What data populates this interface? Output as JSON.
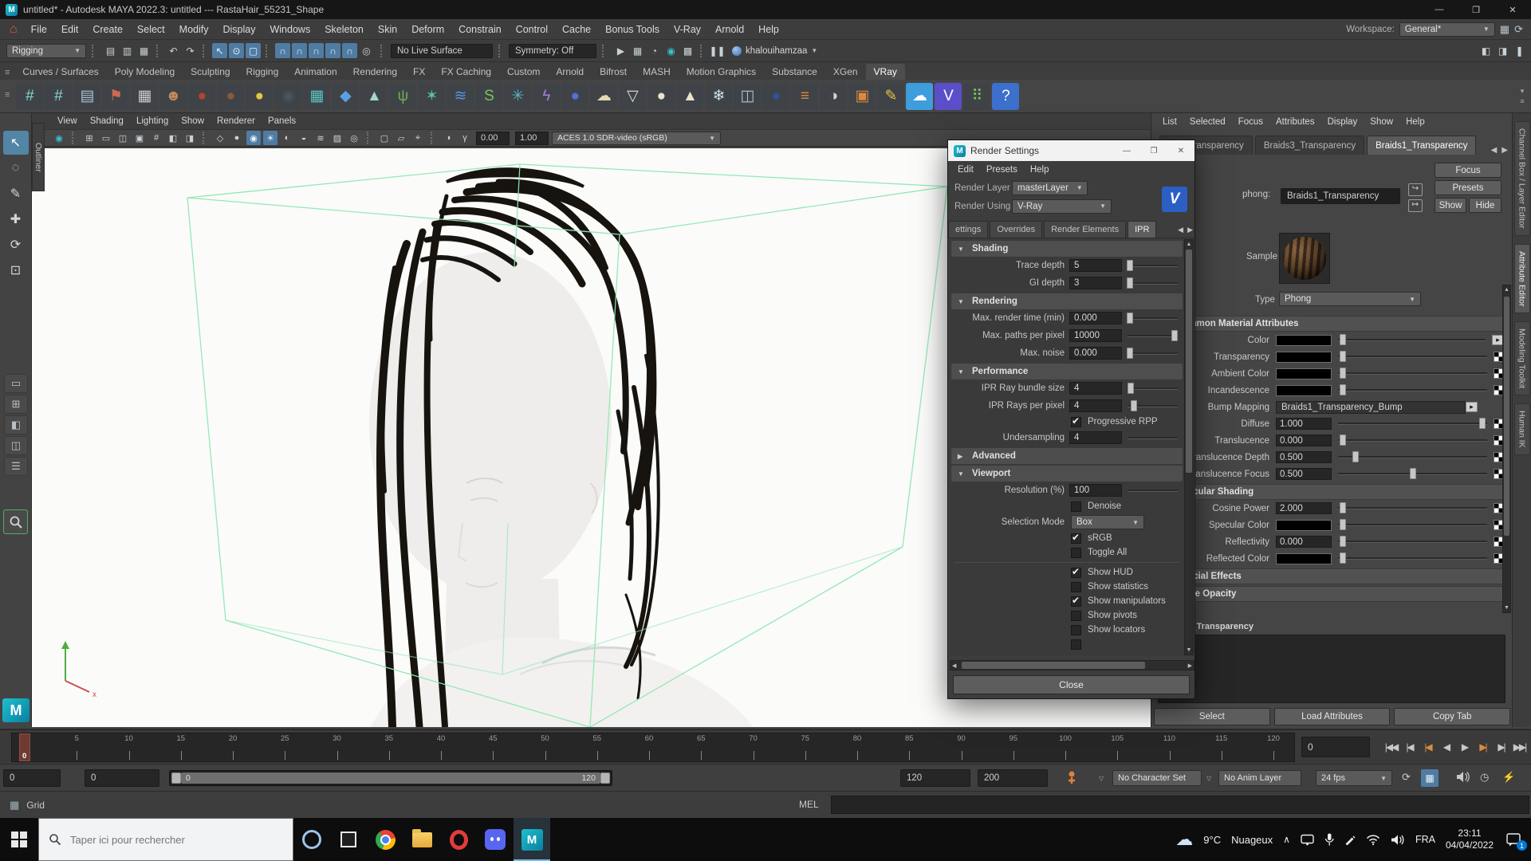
{
  "window": {
    "title": "untitled* - Autodesk MAYA 2022.3: untitled   ---   RastaHair_55231_Shape",
    "minimize": "—",
    "maximize": "❐",
    "close": "✕"
  },
  "menubar": {
    "items": [
      "File",
      "Edit",
      "Create",
      "Select",
      "Modify",
      "Display",
      "Windows",
      "Skeleton",
      "Skin",
      "Deform",
      "Constrain",
      "Control",
      "Cache",
      "Bonus Tools",
      "V-Ray",
      "Arnold",
      "Help"
    ],
    "workspace_label": "Workspace:",
    "workspace_value": "General*"
  },
  "statusline": {
    "menuset": "Rigging",
    "no_live_surface": "No Live Surface",
    "symmetry": "Symmetry: Off",
    "user": "khalouihamzaa",
    "icons_left": [
      {
        "n": "new-scene-icon",
        "g": "▤"
      },
      {
        "n": "open-scene-icon",
        "g": "▥"
      },
      {
        "n": "save-scene-icon",
        "g": "▦"
      },
      {
        "sep": 1
      },
      {
        "n": "undo-icon",
        "g": "↶"
      },
      {
        "n": "redo-icon",
        "g": "↷"
      },
      {
        "sep": 1
      },
      {
        "n": "select-hierarchy-icon",
        "g": "↖",
        "hl": 1
      },
      {
        "n": "select-object-icon",
        "g": "⊙",
        "hl": 1
      },
      {
        "n": "select-component-icon",
        "g": "▢",
        "hl": 1
      },
      {
        "sep": 1
      },
      {
        "n": "snap-to-grid-icon",
        "g": "∩",
        "hl": 1
      },
      {
        "n": "snap-to-curve-icon",
        "g": "∩",
        "hl": 1
      },
      {
        "n": "snap-to-point-icon",
        "g": "∩",
        "hl": 1
      },
      {
        "n": "snap-to-center-icon",
        "g": "∩",
        "hl": 1
      },
      {
        "n": "snap-to-viewplane-icon",
        "g": "∩",
        "hl": 1
      },
      {
        "n": "make-live-icon",
        "g": "◎"
      }
    ],
    "icons_render": [
      {
        "n": "render-view-icon",
        "g": "▶"
      },
      {
        "n": "render-current-frame-icon",
        "g": "▦"
      },
      {
        "n": "ipr-render-icon",
        "g": "◔"
      },
      {
        "n": "render-setup-icon",
        "g": "◉",
        "teal": 1
      },
      {
        "n": "render-settings-icon",
        "g": "▩"
      },
      {
        "sep": 1
      },
      {
        "n": "pause-viewport-icon",
        "g": "❚❚"
      }
    ],
    "icons_right": [
      {
        "n": "modeling-toolkit-toggle-icon",
        "g": "◧"
      },
      {
        "n": "attribute-editor-toggle-icon",
        "g": "◨"
      },
      {
        "n": "tool-settings-toggle-icon",
        "g": "❚"
      }
    ]
  },
  "shelf": {
    "tabs": [
      {
        "label": "Curves / Surfaces"
      },
      {
        "label": "Poly Modeling"
      },
      {
        "label": "Sculpting"
      },
      {
        "label": "Rigging"
      },
      {
        "label": "Animation"
      },
      {
        "label": "Rendering"
      },
      {
        "label": "FX"
      },
      {
        "label": "FX Caching"
      },
      {
        "label": "Custom"
      },
      {
        "label": "Arnold"
      },
      {
        "label": "Bifrost"
      },
      {
        "label": "MASH"
      },
      {
        "label": "Motion Graphics"
      },
      {
        "label": "Substance"
      },
      {
        "label": "XGen"
      },
      {
        "label": "VRay",
        "active": true
      }
    ],
    "icons": [
      {
        "n": "shelf-icon-1",
        "g": "#",
        "c": "#86d7d2"
      },
      {
        "n": "shelf-icon-2",
        "g": "#",
        "c": "#86d7d2"
      },
      {
        "n": "shelf-icon-3",
        "g": "▤",
        "c": "#a9c2d4"
      },
      {
        "n": "shelf-icon-4",
        "g": "⚑",
        "c": "#cd6a52"
      },
      {
        "n": "shelf-icon-5",
        "g": "▦",
        "c": "#cccccc"
      },
      {
        "n": "shelf-icon-6",
        "g": "☻",
        "c": "#c08a5a"
      },
      {
        "n": "shelf-icon-7",
        "g": "●",
        "c": "#b8412f"
      },
      {
        "n": "shelf-icon-8",
        "g": "●",
        "c": "#8a5a38"
      },
      {
        "n": "shelf-icon-9",
        "g": "●",
        "c": "#e3c53f"
      },
      {
        "n": "shelf-icon-10",
        "g": "◉",
        "c": "#49555e"
      },
      {
        "n": "shelf-icon-11",
        "g": "▦",
        "c": "#57c4c4"
      },
      {
        "n": "shelf-icon-12",
        "g": "◆",
        "c": "#5a9fe3"
      },
      {
        "n": "shelf-icon-13",
        "g": "▲",
        "c": "#a3d8cd"
      },
      {
        "n": "shelf-icon-14",
        "g": "ψ",
        "c": "#6fae4f"
      },
      {
        "n": "shelf-icon-15",
        "g": "✶",
        "c": "#57c49e"
      },
      {
        "n": "shelf-icon-16",
        "g": "≋",
        "c": "#5a8fe3"
      },
      {
        "n": "shelf-icon-17",
        "g": "S",
        "c": "#79c45a"
      },
      {
        "n": "shelf-icon-18",
        "g": "✳",
        "c": "#57b2c4"
      },
      {
        "n": "shelf-icon-19",
        "g": "ϟ",
        "c": "#a87fdd"
      },
      {
        "n": "shelf-icon-20",
        "g": "●",
        "c": "#4f72d4"
      },
      {
        "n": "shelf-icon-21",
        "g": "☁",
        "c": "#e3d8b2"
      },
      {
        "n": "shelf-icon-22",
        "g": "▽",
        "c": "#dddddd"
      },
      {
        "n": "shelf-icon-23",
        "g": "●",
        "c": "#ece3cc"
      },
      {
        "n": "shelf-icon-24",
        "g": "▲",
        "c": "#ece3cc"
      },
      {
        "n": "shelf-icon-25",
        "g": "❄",
        "c": "#cde3ec"
      },
      {
        "n": "shelf-icon-26",
        "g": "◫",
        "c": "#a9c2d4"
      },
      {
        "n": "shelf-icon-27",
        "g": "●",
        "c": "#31519e"
      },
      {
        "n": "shelf-icon-28",
        "g": "≡",
        "c": "#dd8a3d"
      },
      {
        "n": "shelf-icon-29",
        "g": "◑",
        "c": "#d8d8d8"
      },
      {
        "n": "shelf-icon-30",
        "g": "▣",
        "c": "#dd8a3d"
      },
      {
        "n": "shelf-icon-31",
        "g": "✎",
        "c": "#e3c53f"
      },
      {
        "n": "shelf-icon-32",
        "g": "☁",
        "c": "#ffffff",
        "bg": "#3d9ddd"
      },
      {
        "n": "shelf-icon-33",
        "g": "V",
        "c": "#ffffff",
        "bg": "#5a4fc9"
      },
      {
        "n": "shelf-icon-34",
        "g": "⠿",
        "c": "#79c45a"
      },
      {
        "n": "shelf-icon-35",
        "g": "?",
        "c": "#ffffff",
        "bg": "#3d6fcc"
      }
    ]
  },
  "toolbox": {
    "tools": [
      {
        "n": "select-tool-icon",
        "g": "↖",
        "hl": 1
      },
      {
        "n": "lasso-select-tool-icon",
        "g": "◌"
      },
      {
        "n": "paint-select-tool-icon",
        "g": "✎"
      },
      {
        "n": "move-tool-icon",
        "g": "✚"
      },
      {
        "n": "rotate-tool-icon",
        "g": "⟳"
      },
      {
        "n": "scale-tool-icon",
        "g": "⊡"
      }
    ],
    "layouts": [
      {
        "n": "layout-single-pane-icon",
        "g": "▭"
      },
      {
        "n": "layout-four-pane-icon",
        "g": "⊞"
      },
      {
        "n": "layout-persp-outliner-icon",
        "g": "◧"
      },
      {
        "n": "layout-two-pane-icon",
        "g": "◫"
      },
      {
        "n": "layout-hypershade-icon",
        "g": "☰"
      }
    ]
  },
  "viewport": {
    "outliner_tab": "Outliner",
    "menus": [
      "View",
      "Shading",
      "Lighting",
      "Show",
      "Renderer",
      "Panels"
    ],
    "icons": [
      {
        "n": "vp-camera-icon",
        "g": "◉",
        "teal": 1
      },
      {
        "sep": 1
      },
      {
        "n": "vp-grid-icon",
        "g": "⊞"
      },
      {
        "n": "vp-film-gate-icon",
        "g": "▭"
      },
      {
        "n": "vp-resolution-gate-icon",
        "g": "◫"
      },
      {
        "n": "vp-gate-mask-icon",
        "g": "▣"
      },
      {
        "n": "vp-field-chart-icon",
        "g": "#"
      },
      {
        "n": "vp-safe-action-icon",
        "g": "◧"
      },
      {
        "n": "vp-safe-title-icon",
        "g": "◨"
      },
      {
        "sep": 1
      },
      {
        "n": "vp-wireframe-icon",
        "g": "◇"
      },
      {
        "n": "vp-shaded-icon",
        "g": "●"
      },
      {
        "n": "vp-textured-icon",
        "g": "◉",
        "hl": 1
      },
      {
        "n": "vp-lights-icon",
        "g": "☀",
        "hl": 1
      },
      {
        "n": "vp-shadows-icon",
        "g": "◐"
      },
      {
        "n": "vp-ao-icon",
        "g": "◒"
      },
      {
        "n": "vp-motion-blur-icon",
        "g": "≋"
      },
      {
        "n": "vp-antialias-icon",
        "g": "▨"
      },
      {
        "n": "vp-dof-icon",
        "g": "◎"
      },
      {
        "sep": 1
      },
      {
        "n": "vp-isolate-select-icon",
        "g": "▢"
      },
      {
        "n": "vp-xray-icon",
        "g": "▱"
      },
      {
        "n": "vp-joint-xray-icon",
        "g": "⌖"
      },
      {
        "sep": 1
      },
      {
        "n": "vp-exposure-icon",
        "g": "◑"
      },
      {
        "n": "vp-gamma-icon",
        "g": "γ"
      }
    ],
    "exposure": "0.00",
    "gamma": "1.00",
    "colorspace": "ACES 1.0 SDR-video (sRGB)"
  },
  "render_settings": {
    "title": "Render Settings",
    "menu": [
      "Edit",
      "Presets",
      "Help"
    ],
    "render_layer_label": "Render Layer",
    "render_layer_value": "masterLayer",
    "render_using_label": "Render Using",
    "render_using_value": "V-Ray",
    "tabs": [
      {
        "label": "ettings"
      },
      {
        "label": "Overrides"
      },
      {
        "label": "Render Elements"
      },
      {
        "label": "IPR",
        "active": true
      }
    ],
    "sections": [
      {
        "title": "Shading",
        "collapsed": false,
        "rows": [
          {
            "type": "slider",
            "label": "Trace depth",
            "value": "5",
            "handle": 0.04
          },
          {
            "type": "slider",
            "label": "GI depth",
            "value": "3",
            "handle": 0.04
          }
        ]
      },
      {
        "title": "Rendering",
        "collapsed": false,
        "rows": [
          {
            "type": "slider",
            "label": "Max. render time (min)",
            "value": "0.000",
            "handle": 0.04
          },
          {
            "type": "slider",
            "label": "Max. paths per pixel",
            "value": "10000",
            "handle": 0.93
          },
          {
            "type": "slider",
            "label": "Max. noise",
            "value": "0.000",
            "handle": 0.04
          }
        ]
      },
      {
        "type_note": "",
        "title": "Performance",
        "collapsed": false,
        "rows": [
          {
            "type": "slider",
            "label": "IPR Ray bundle size",
            "value": "4",
            "handle": 0.06
          },
          {
            "type": "slider",
            "label": "IPR Rays per pixel",
            "value": "4",
            "handle": 0.12
          },
          {
            "type": "checkbox",
            "label": "Progressive RPP",
            "checked": true
          },
          {
            "type": "slider",
            "label": "Undersampling",
            "value": "4",
            "handle": null
          }
        ]
      },
      {
        "title": "Advanced",
        "collapsed": true,
        "rows": []
      },
      {
        "title": "Viewport",
        "collapsed": false,
        "rows": [
          {
            "type": "slider",
            "label": "Resolution (%)",
            "value": "100",
            "handle": null
          },
          {
            "type": "checkbox",
            "label": "Denoise",
            "checked": false
          },
          {
            "type": "dropdown",
            "label": "Selection Mode",
            "value": "Box"
          },
          {
            "type": "checkbox",
            "label": "sRGB",
            "checked": true
          },
          {
            "type": "checkbox",
            "label": "Toggle All",
            "checked": false
          },
          {
            "type": "sep"
          },
          {
            "type": "checkbox",
            "label": "Show HUD",
            "checked": true
          },
          {
            "type": "checkbox",
            "label": "Show statistics",
            "checked": false
          },
          {
            "type": "checkbox",
            "label": "Show manipulators",
            "checked": true
          },
          {
            "type": "checkbox",
            "label": "Show pivots",
            "checked": false
          },
          {
            "type": "checkbox",
            "label": "Show locators",
            "checked": false
          },
          {
            "type": "checkbox",
            "label": "",
            "checked": false
          }
        ]
      }
    ],
    "close_label": "Close"
  },
  "attribute_editor": {
    "menu": [
      "List",
      "Selected",
      "Focus",
      "Attributes",
      "Display",
      "Show",
      "Help"
    ],
    "tabs": [
      {
        "label": "urls_Transparency"
      },
      {
        "label": "Braids3_Transparency"
      },
      {
        "label": "Braids1_Transparency",
        "active": true
      }
    ],
    "node_type_label": "phong:",
    "node_name": "Braids1_Transparency",
    "buttons": {
      "focus": "Focus",
      "presets": "Presets",
      "show": "Show",
      "hide": "Hide"
    },
    "sample_label": "Sample",
    "type_label": "Type",
    "type_value": "Phong",
    "swatch_color": "#000000",
    "sections": [
      {
        "title": "Common Material Attributes",
        "collapsed": false,
        "rows": [
          {
            "label": "Color",
            "kind": "swatch",
            "handle": 0.03,
            "icon": "map"
          },
          {
            "label": "Transparency",
            "kind": "swatch",
            "handle": 0.03,
            "icon": "checker"
          },
          {
            "label": "Ambient Color",
            "kind": "swatch",
            "handle": 0.03,
            "icon": "checker"
          },
          {
            "label": "Incandescence",
            "kind": "swatch",
            "handle": 0.03,
            "icon": "checker"
          },
          {
            "label": "Bump Mapping",
            "kind": "text",
            "value": "Braids1_Transparency_Bump",
            "icon": "map"
          },
          {
            "label": "Diffuse",
            "kind": "number",
            "value": "1.000",
            "handle": 0.97,
            "icon": "checker"
          },
          {
            "label": "Translucence",
            "kind": "number",
            "value": "0.000",
            "handle": 0.03,
            "icon": "checker"
          },
          {
            "label": "Translucence Depth",
            "kind": "number",
            "value": "0.500",
            "handle": 0.12,
            "icon": "checker"
          },
          {
            "label": "Translucence Focus",
            "kind": "number",
            "value": "0.500",
            "handle": 0.5,
            "icon": "checker"
          }
        ]
      },
      {
        "title": "Specular Shading",
        "collapsed": false,
        "rows": [
          {
            "label": "Cosine Power",
            "kind": "number",
            "value": "2.000",
            "handle": 0.03,
            "icon": "checker"
          },
          {
            "label": "Specular Color",
            "kind": "swatch",
            "handle": 0.03,
            "icon": "checker"
          },
          {
            "label": "Reflectivity",
            "kind": "number",
            "value": "0.000",
            "handle": 0.03,
            "icon": "checker"
          },
          {
            "label": "Reflected Color",
            "kind": "swatch",
            "handle": 0.03,
            "icon": "checker"
          }
        ]
      },
      {
        "title": "Special Effects",
        "collapsed": true,
        "rows": []
      },
      {
        "title": "Matte Opacity",
        "collapsed": true,
        "rows": []
      }
    ],
    "notes_label": "Braids1_Transparency",
    "footer_buttons": [
      "Select",
      "Load Attributes",
      "Copy Tab"
    ],
    "side_tabs": [
      {
        "label": "Channel Box / Layer Editor"
      },
      {
        "label": "Attribute Editor",
        "active": true
      },
      {
        "label": "Modeling Toolkit"
      },
      {
        "label": "Human IK"
      }
    ]
  },
  "timeline": {
    "tick_start": 0,
    "tick_end": 120,
    "tick_step": 5,
    "current_frame": "0",
    "current_time_value": "0",
    "transport": [
      {
        "n": "go-to-start-button",
        "g": "|◀◀"
      },
      {
        "n": "step-back-frame-button",
        "g": "|◀"
      },
      {
        "n": "step-back-key-button",
        "g": "|◀",
        "accent": 1
      },
      {
        "n": "play-backwards-button",
        "g": "◀"
      },
      {
        "n": "play-forwards-button",
        "g": "▶"
      },
      {
        "n": "step-forward-key-button",
        "g": "▶|",
        "accent": 1
      },
      {
        "n": "step-forward-frame-button",
        "g": "▶|"
      },
      {
        "n": "go-to-end-button",
        "g": "▶▶|"
      }
    ]
  },
  "range_bar": {
    "anim_start": "0",
    "playback_start": "0",
    "range_label_start": "0",
    "range_label_end": "120",
    "playback_end": "120",
    "anim_end": "200",
    "character_set": "No Character Set",
    "anim_layer": "No Anim Layer",
    "fps": "24 fps"
  },
  "command_line": {
    "help_text": "Grid",
    "mel_label": "MEL"
  },
  "taskbar": {
    "search_placeholder": "Taper ici pour rechercher",
    "apps": [
      "cortana",
      "task-view",
      "chrome",
      "file-explorer",
      "opera",
      "discord",
      "maya"
    ],
    "active_app": "maya",
    "tray_icons": [
      "chevron-up",
      "cast",
      "microphone",
      "pen",
      "wifi",
      "volume"
    ],
    "temperature": "9°C",
    "weather": "Nuageux",
    "language": "FRA",
    "time": "23:11",
    "date": "04/04/2022",
    "notification_count": "1"
  }
}
